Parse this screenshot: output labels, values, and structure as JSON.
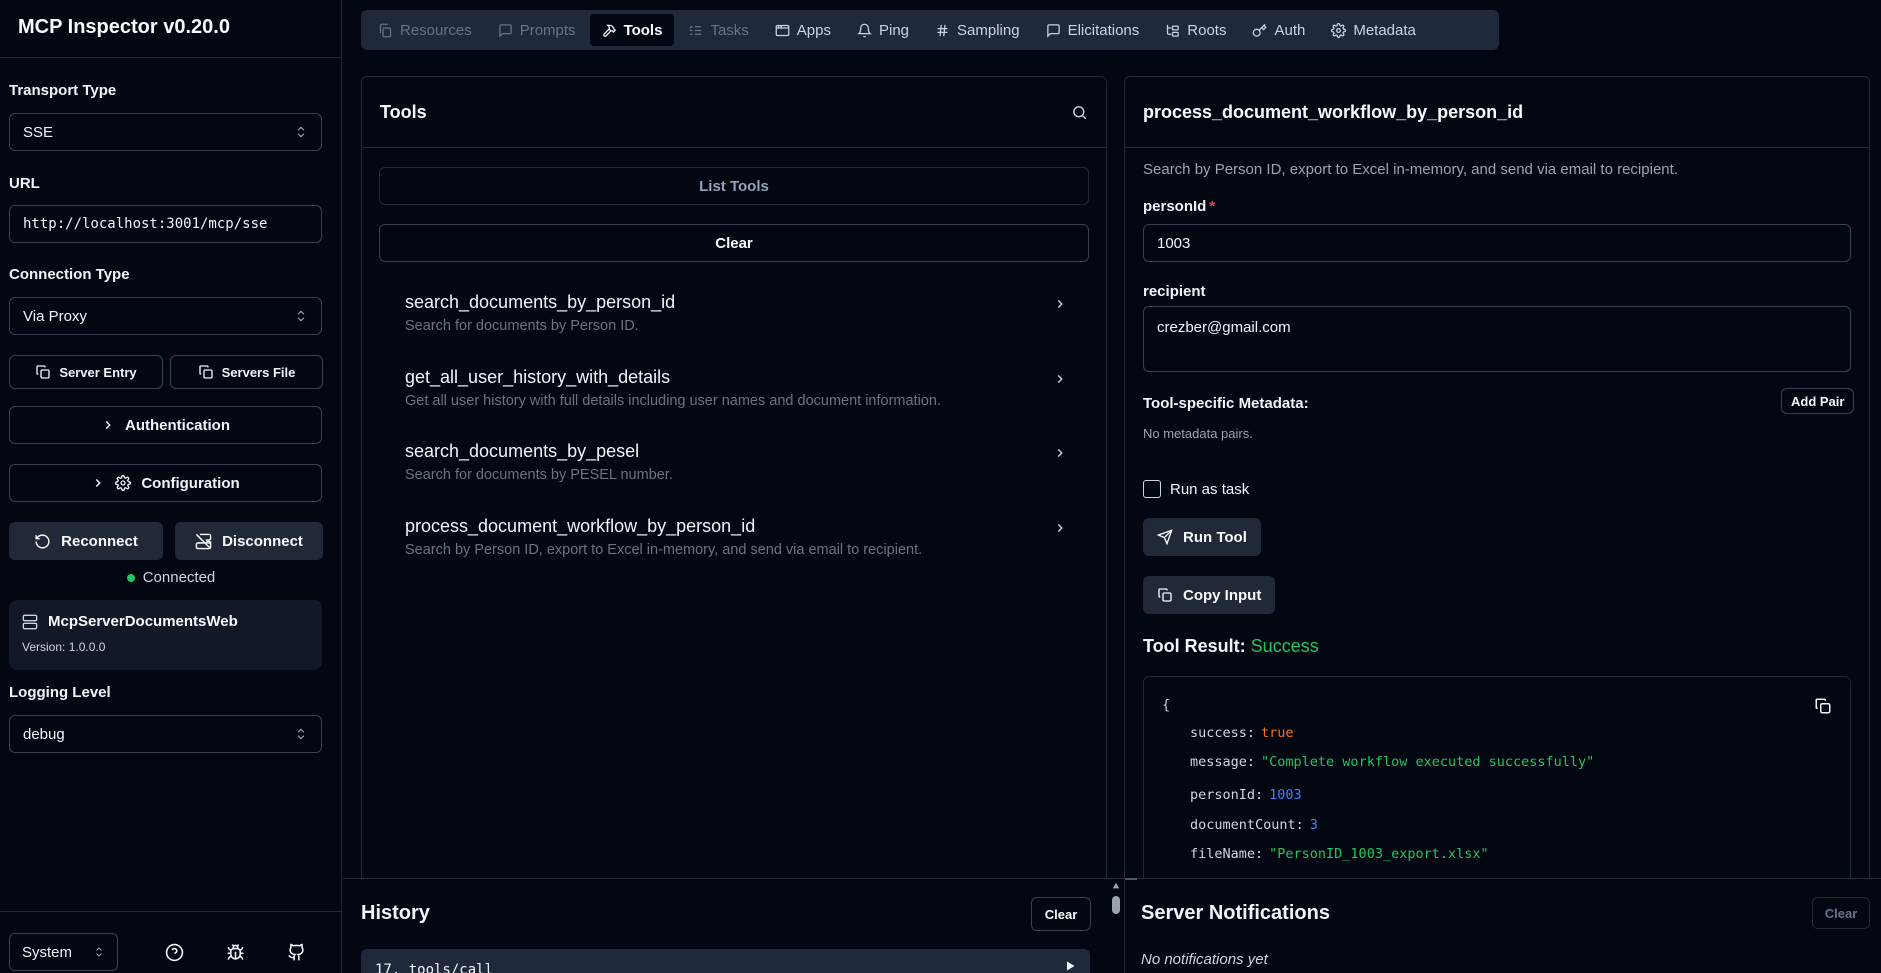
{
  "app": {
    "title": "MCP Inspector v0.20.0"
  },
  "sidebar": {
    "transport_label": "Transport Type",
    "transport_value": "SSE",
    "url_label": "URL",
    "url_value": "http://localhost:3001/mcp/sse",
    "connection_label": "Connection Type",
    "connection_value": "Via Proxy",
    "server_entry": "Server Entry",
    "servers_file": "Servers File",
    "authentication": "Authentication",
    "configuration": "Configuration",
    "reconnect": "Reconnect",
    "disconnect": "Disconnect",
    "status": "Connected",
    "server_name": "McpServerDocumentsWeb",
    "server_version": "Version: 1.0.0.0",
    "logging_label": "Logging Level",
    "logging_value": "debug",
    "theme_value": "System"
  },
  "tabs": [
    {
      "label": "Resources",
      "icon": "files-icon",
      "state": "disabled"
    },
    {
      "label": "Prompts",
      "icon": "message-icon",
      "state": "disabled"
    },
    {
      "label": "Tools",
      "icon": "hammer-icon",
      "state": "active"
    },
    {
      "label": "Tasks",
      "icon": "list-check-icon",
      "state": "disabled"
    },
    {
      "label": "Apps",
      "icon": "app-window-icon",
      "state": "normal"
    },
    {
      "label": "Ping",
      "icon": "bell-icon",
      "state": "normal"
    },
    {
      "label": "Sampling",
      "icon": "hash-icon",
      "state": "normal"
    },
    {
      "label": "Elicitations",
      "icon": "message-square-icon",
      "state": "normal"
    },
    {
      "label": "Roots",
      "icon": "folder-tree-icon",
      "state": "normal"
    },
    {
      "label": "Auth",
      "icon": "key-icon",
      "state": "normal"
    },
    {
      "label": "Metadata",
      "icon": "gear-icon",
      "state": "normal"
    }
  ],
  "tools_panel": {
    "title": "Tools",
    "list_button": "List Tools",
    "clear_button": "Clear",
    "items": [
      {
        "name": "search_documents_by_person_id",
        "description": "Search for documents by Person ID."
      },
      {
        "name": "get_all_user_history_with_details",
        "description": "Get all user history with full details including user names and document information."
      },
      {
        "name": "search_documents_by_pesel",
        "description": "Search for documents by PESEL number."
      },
      {
        "name": "process_document_workflow_by_person_id",
        "description": "Search by Person ID, export to Excel in-memory, and send via email to recipient."
      }
    ]
  },
  "detail": {
    "title": "process_document_workflow_by_person_id",
    "description": "Search by Person ID, export to Excel in-memory, and send via email to recipient.",
    "person_label": "personId",
    "required_mark": "*",
    "person_value": "1003",
    "recipient_label": "recipient",
    "recipient_value": "crezber@gmail.com",
    "metadata_label": "Tool-specific Metadata:",
    "add_pair": "Add Pair",
    "no_metadata": "No metadata pairs.",
    "run_as_task": "Run as task",
    "run_tool": "Run Tool",
    "copy_input": "Copy Input",
    "result_label": "Tool Result:",
    "result_status": "Success",
    "json": {
      "open": "{",
      "lines": [
        {
          "key": "success:",
          "value": "true",
          "kind": "bool"
        },
        {
          "key": "message:",
          "value": "\"Complete workflow executed successfully\"",
          "kind": "str"
        },
        {
          "key": "personId:",
          "value": "1003",
          "kind": "num"
        },
        {
          "key": "documentCount:",
          "value": "3",
          "kind": "num"
        },
        {
          "key": "fileName:",
          "value": "\"PersonID_1003_export.xlsx\"",
          "kind": "str"
        }
      ]
    }
  },
  "history": {
    "title": "History",
    "clear": "Clear",
    "first_entry": "17. tools/call"
  },
  "notifications": {
    "title": "Server Notifications",
    "clear": "Clear",
    "empty": "No notifications yet"
  }
}
